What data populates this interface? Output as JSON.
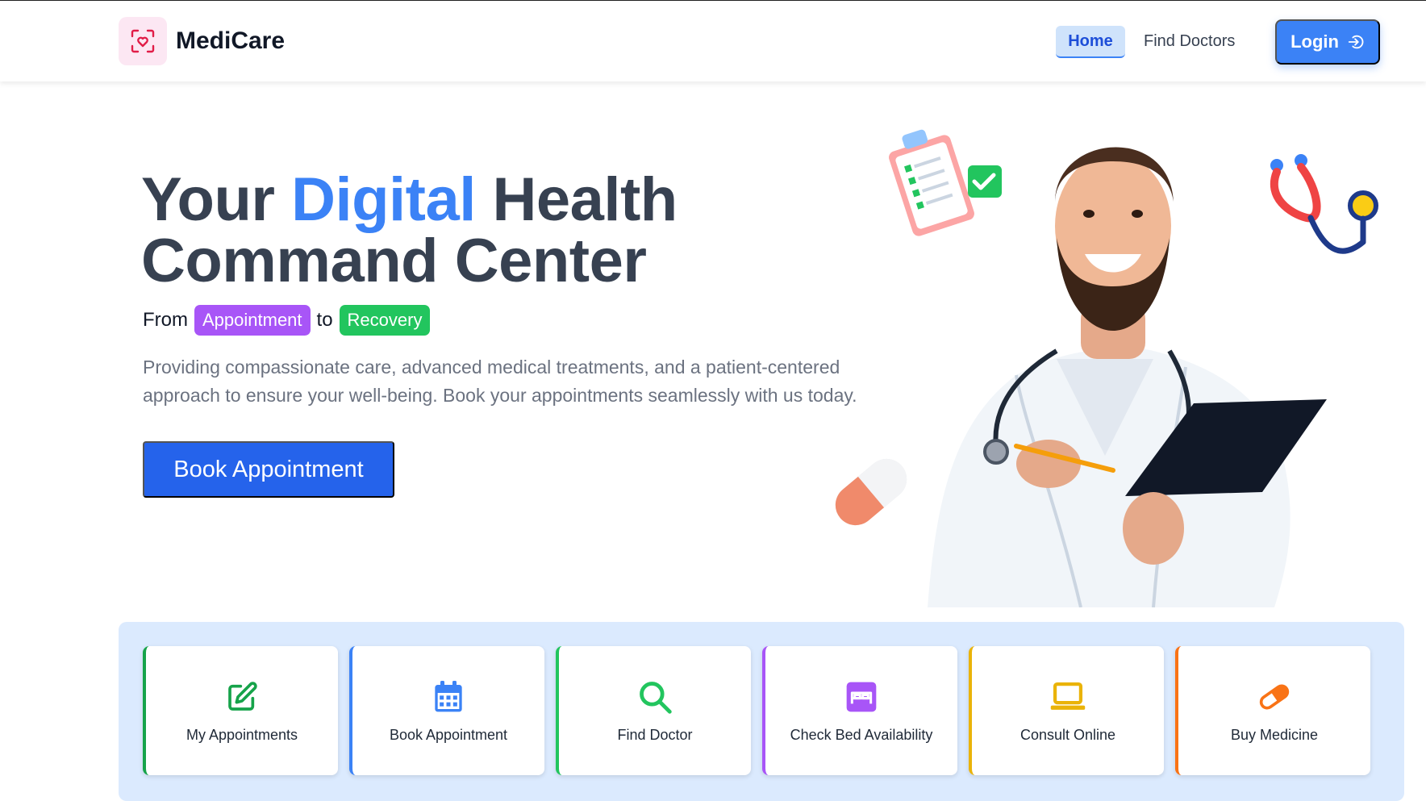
{
  "brand": {
    "name": "MediCare"
  },
  "nav": {
    "home": "Home",
    "find_doctors": "Find Doctors",
    "login": "Login"
  },
  "hero": {
    "title_part1": "Your ",
    "title_accent": "Digital",
    "title_part2": " Health",
    "title_line2": "Command Center",
    "tagline_from": "From",
    "tagline_pill1": "Appointment",
    "tagline_to": "to",
    "tagline_pill2": "Recovery",
    "description": "Providing compassionate care, advanced medical treatments, and a patient-centered approach to ensure your well-being. Book your appointments seamlessly with us today.",
    "cta": "Book Appointment"
  },
  "quick_actions": [
    {
      "label": "My Appointments",
      "icon": "edit-icon",
      "color": "#16a34a"
    },
    {
      "label": "Book Appointment",
      "icon": "calendar-icon",
      "color": "#3b82f6"
    },
    {
      "label": "Find Doctor",
      "icon": "search-icon",
      "color": "#22c55e"
    },
    {
      "label": "Check Bed Availability",
      "icon": "bed-icon",
      "color": "#a855f7"
    },
    {
      "label": "Consult Online",
      "icon": "laptop-icon",
      "color": "#eab308"
    },
    {
      "label": "Buy Medicine",
      "icon": "pill-icon",
      "color": "#f97316"
    }
  ],
  "colors": {
    "primary": "#3b82f6",
    "cta": "#2563eb",
    "panel": "#dbeafe"
  }
}
